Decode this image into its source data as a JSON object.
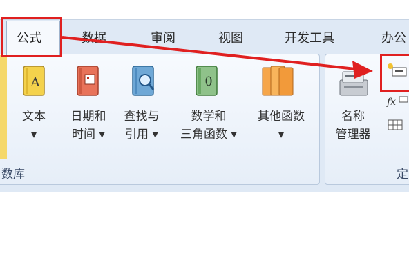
{
  "tabs": {
    "active": "公式",
    "items": [
      "数据",
      "审阅",
      "视图",
      "开发工具",
      "办公"
    ]
  },
  "ribbon": {
    "buttons": [
      {
        "line1": "文本",
        "line2": "▾"
      },
      {
        "line1": "日期和",
        "line2": "时间 ▾"
      },
      {
        "line1": "查找与",
        "line2": "引用 ▾"
      },
      {
        "line1": "数学和",
        "line2": "三角函数 ▾"
      },
      {
        "line1": "其他函数",
        "line2": "▾"
      }
    ],
    "group1_label": "数库",
    "name_manager": {
      "line1": "名称",
      "line2": "管理器"
    },
    "group2_label": "定"
  },
  "icons": {
    "text_book": "book-A-icon",
    "date_book": "calendar-book-icon",
    "lookup_book": "magnifier-book-icon",
    "math_book": "theta-book-icon",
    "other_book": "stack-books-icon",
    "name_manager": "name-manager-icon",
    "define_name": "define-name-icon",
    "use_in_formula": "fx-icon",
    "create_from_selection": "grid-icon"
  },
  "colors": {
    "highlight": "#e02020",
    "ribbon_bg": "#dfe9f5"
  }
}
